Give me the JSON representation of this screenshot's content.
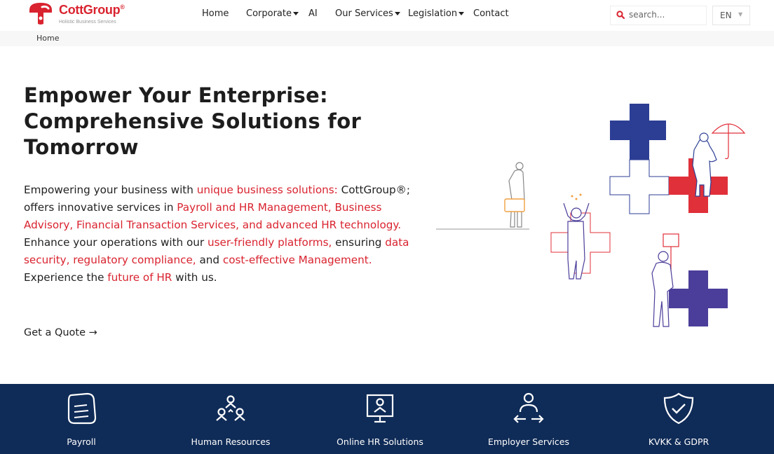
{
  "brand": {
    "name": "CottGroup",
    "reg_mark": "®",
    "tagline": "Holistic Business Services",
    "color": "#d9232f"
  },
  "nav": {
    "items": [
      {
        "label": "Home",
        "has_dropdown": false
      },
      {
        "label": "Corporate",
        "has_dropdown": true
      },
      {
        "label": "AI",
        "has_dropdown": false
      },
      {
        "label": "Our Services",
        "has_dropdown": true
      },
      {
        "label": "Legislation",
        "has_dropdown": true
      },
      {
        "label": "Contact",
        "has_dropdown": false
      }
    ]
  },
  "search": {
    "placeholder": "search...",
    "icon": "search-icon"
  },
  "language": {
    "selected": "EN",
    "caret": "▼"
  },
  "breadcrumb": {
    "current": "Home"
  },
  "hero": {
    "title": "Empower Your Enterprise: Comprehensive Solutions for Tomorrow",
    "description_parts": [
      {
        "text": "Empowering your business with ",
        "highlight": false
      },
      {
        "text": "unique business solutions:",
        "highlight": true
      },
      {
        "text": " CottGroup®; offers innovative services in ",
        "highlight": false
      },
      {
        "text": "Payroll and HR Management, Business Advisory, Financial Transaction Services, and advanced HR technology.",
        "highlight": true
      },
      {
        "text": " Enhance your operations with our ",
        "highlight": false
      },
      {
        "text": "user-friendly platforms,",
        "highlight": true
      },
      {
        "text": " ensuring ",
        "highlight": false
      },
      {
        "text": "data security, regulatory compliance,",
        "highlight": true
      },
      {
        "text": " and ",
        "highlight": false
      },
      {
        "text": "cost-effective Management.",
        "highlight": true
      },
      {
        "text": " Experience the ",
        "highlight": false
      },
      {
        "text": "future of HR",
        "highlight": true
      },
      {
        "text": " with us.",
        "highlight": false
      }
    ],
    "cta_label": "Get a Quote",
    "cta_arrow": "→",
    "highlight_color": "#d9232f"
  },
  "services": {
    "background": "#0f2b57",
    "items": [
      {
        "label": "Payroll",
        "icon": "document-icon"
      },
      {
        "label": "Human Resources",
        "icon": "people-icon"
      },
      {
        "label": "Online HR Solutions",
        "icon": "monitor-user-icon"
      },
      {
        "label": "Employer Services",
        "icon": "employer-exchange-icon"
      },
      {
        "label": "KVKK & GDPR",
        "icon": "shield-check-icon"
      }
    ]
  }
}
